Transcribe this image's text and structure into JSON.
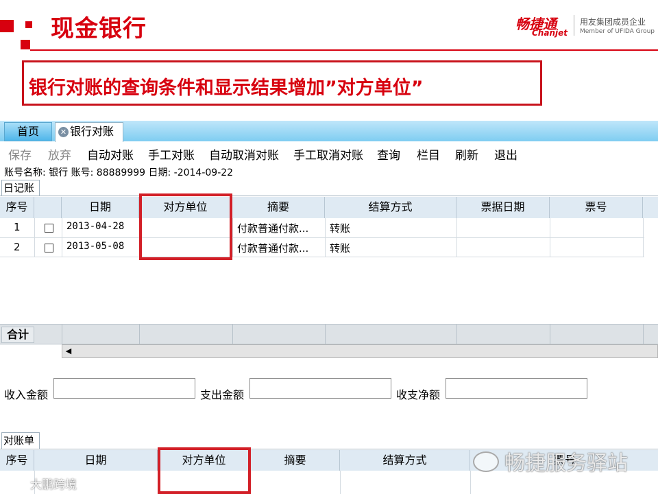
{
  "header": {
    "title": "现金银行",
    "logo_cn": "畅捷通",
    "logo_en": "Chanjet",
    "tagline_cn": "用友集团成员企业",
    "tagline_en": "Member of UFIDA Group",
    "callout": "银行对账的查询条件和显示结果增加”对方单位”",
    "brand_color": "#d7000f"
  },
  "tabs": [
    {
      "label": "首页"
    },
    {
      "label": "银行对账",
      "close_icon": "close-icon"
    }
  ],
  "toolbar": {
    "save": "保存",
    "discard": "放弃",
    "auto_reconcile": "自动对账",
    "manual_reconcile": "手工对账",
    "auto_cancel": "自动取消对账",
    "manual_cancel": "手工取消对账",
    "query": "查询",
    "columns": "栏目",
    "refresh": "刷新",
    "exit": "退出"
  },
  "account_info": "账号名称: 银行 账号: 88889999 日期: -2014-09-22",
  "daybook": {
    "tab": "日记账",
    "columns": [
      "序号",
      "",
      "日期",
      "对方单位",
      "摘要",
      "结算方式",
      "票据日期",
      "票号"
    ],
    "rows": [
      {
        "no": "1",
        "date": "2013-04-28",
        "counterparty": "",
        "summary": "付款普通付款...",
        "method": "转账",
        "bill_date": "",
        "bill_no": ""
      },
      {
        "no": "2",
        "date": "2013-05-08",
        "counterparty": "",
        "summary": "付款普通付款...",
        "method": "转账",
        "bill_date": "",
        "bill_no": ""
      }
    ],
    "total_label": "合计"
  },
  "summary_fields": {
    "income_label": "收入金额",
    "expense_label": "支出金额",
    "net_label": "收支净额",
    "income_value": "",
    "expense_value": "",
    "net_value": ""
  },
  "statement": {
    "tab": "对账单",
    "columns": [
      "序号",
      "日期",
      "对方单位",
      "摘要",
      "结算方式",
      "票号"
    ]
  },
  "watermarks": {
    "wechat": "畅捷服务驿站",
    "corner": "大鹏跨境"
  }
}
